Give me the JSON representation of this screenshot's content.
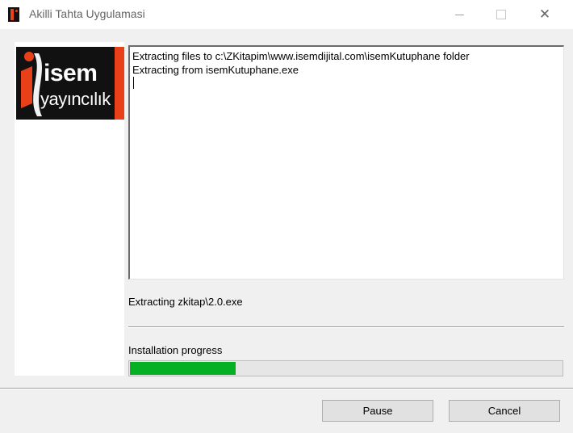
{
  "window": {
    "title": "Akilli Tahta Uygulamasi",
    "icon": "isem-app-icon",
    "controls": [
      "minimize-icon",
      "maximize-icon",
      "close-icon"
    ],
    "close_glyph": "✕"
  },
  "logo": {
    "line1": "isem",
    "line2": "yayıncılık",
    "colors": {
      "accent": "#e8411a",
      "dark": "#111111"
    }
  },
  "log": {
    "lines": [
      "Extracting files to c:\\ZKitapim\\www.isemdijital.com\\isemKutuphane folder",
      "Extracting from isemKutuphane.exe"
    ]
  },
  "status": {
    "text": "Extracting zkitap\\2.0.exe"
  },
  "progress": {
    "label": "Installation progress",
    "fraction": 0.245,
    "color": "#06b025"
  },
  "buttons": {
    "pause": "Pause",
    "cancel": "Cancel"
  }
}
